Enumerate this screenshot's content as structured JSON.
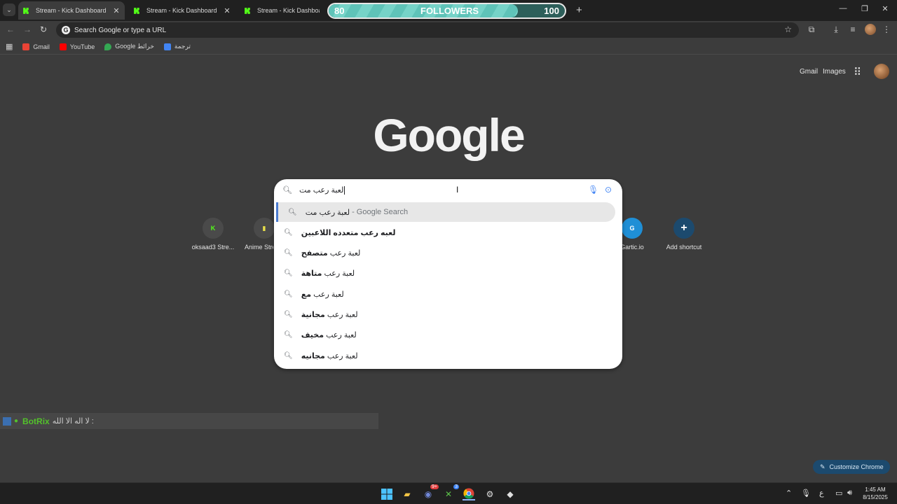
{
  "colors": {
    "kick_green": "#53fc18",
    "botrix_green": "#53c22b",
    "accent_blue": "#4a7bd0",
    "followers_fill": "#5fc3b8"
  },
  "tabs": [
    {
      "title": "Stream - Kick Dashboard",
      "icon": "kick-icon"
    },
    {
      "title": "Stream - Kick Dashboard",
      "icon": "kick-icon"
    },
    {
      "title": "Stream - Kick Dashboard",
      "icon": "kick-icon"
    }
  ],
  "followers": {
    "current": "80",
    "label": "FOLLOWERS",
    "goal": "100",
    "progress": 0.8
  },
  "omnibox": {
    "placeholder": "Search Google or type a URL"
  },
  "bookmarks": [
    {
      "label": "Gmail",
      "icon": "gmail-icon"
    },
    {
      "label": "YouTube",
      "icon": "youtube-icon"
    },
    {
      "label": "Google خرائط",
      "icon": "maps-icon"
    },
    {
      "label": "ترجمة",
      "icon": "translate-icon"
    }
  ],
  "ntp": {
    "gmail": "Gmail",
    "images": "Images",
    "logo": "Google"
  },
  "shortcuts": [
    {
      "label": "oksaad3 Stre...",
      "glyph": "K"
    },
    {
      "label": "Anime Stre...",
      "glyph": "▮"
    },
    {
      "label": "Gartic.io",
      "glyph": "G"
    },
    {
      "label": "Add shortcut",
      "glyph": "+"
    }
  ],
  "search": {
    "query": "لعبة رعب مت",
    "suggestions": [
      {
        "prefix": "لعبة رعب مت",
        "suffix": "- Google Search"
      },
      {
        "prefix": "",
        "bold": "لعبه رعب متعدده اللاعبين"
      },
      {
        "prefix": "لعبة رعب ",
        "bold": "متصفح"
      },
      {
        "prefix": "لعبة رعب ",
        "bold": "متاهة"
      },
      {
        "prefix": "لعبة رعب ",
        "bold": "مع"
      },
      {
        "prefix": "لعبة رعب ",
        "bold": "مجانية"
      },
      {
        "prefix": "لعبة رعب ",
        "bold": "مخيف"
      },
      {
        "prefix": "لعبة رعب ",
        "bold": "مجانيه"
      }
    ]
  },
  "botrix": {
    "name": "BotRix",
    "message": ": لا اله الا الله"
  },
  "customize": {
    "label": "Customize Chrome"
  },
  "taskbar": {
    "lang": "ع",
    "time": "1:45 AM",
    "date": "8/15/2025",
    "discord_badge": "9+",
    "xbox_badge": "3"
  }
}
